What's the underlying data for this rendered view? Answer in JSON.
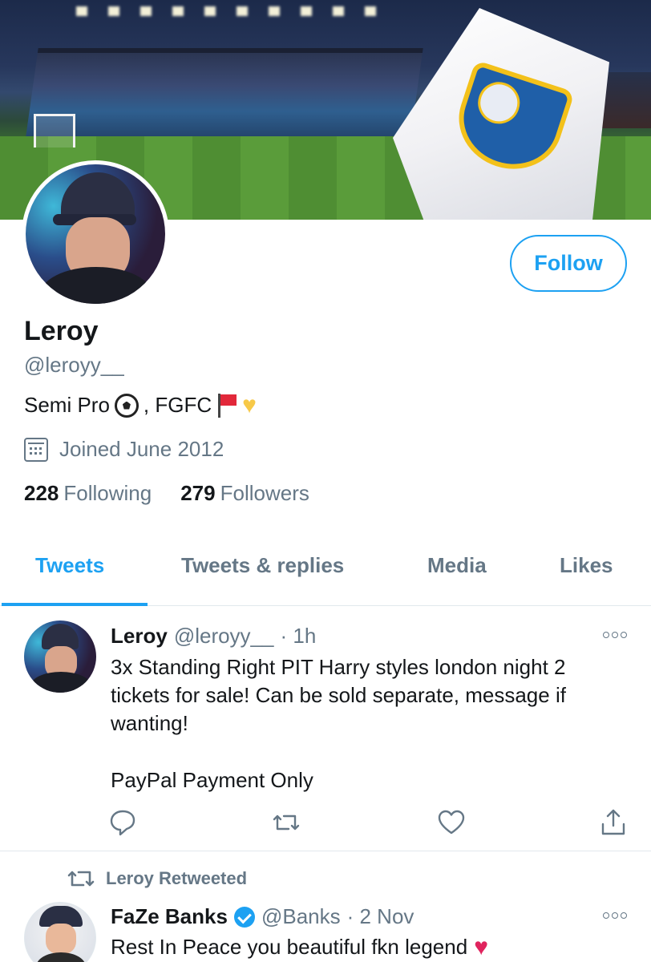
{
  "profile": {
    "name": "Leroy",
    "handle": "@leroyy__",
    "bio_text": "Semi Pro",
    "bio_text2": ", FGFC",
    "joined": "Joined June 2012",
    "following_count": "228",
    "following_label": "Following",
    "followers_count": "279",
    "followers_label": "Followers",
    "follow_button": "Follow"
  },
  "tabs": [
    {
      "label": "Tweets",
      "active": true
    },
    {
      "label": "Tweets & replies",
      "active": false
    },
    {
      "label": "Media",
      "active": false
    },
    {
      "label": "Likes",
      "active": false
    }
  ],
  "tweets": [
    {
      "name": "Leroy",
      "handle": "@leroyy__",
      "time": "· 1h",
      "text": "3x Standing Right PIT Harry styles london night 2 tickets for sale! Can be sold separate, message if wanting!",
      "text2": "PayPal Payment Only"
    },
    {
      "retweet_label": "Leroy Retweeted",
      "name": "FaZe Banks",
      "handle": "@Banks",
      "time": "· 2 Nov",
      "text": "Rest In Peace you beautiful fkn legend"
    }
  ],
  "colors": {
    "accent": "#1da1f2",
    "muted": "#657786",
    "text": "#14171a",
    "heart_red": "#e0245e",
    "heart_yellow": "#f7c948"
  }
}
